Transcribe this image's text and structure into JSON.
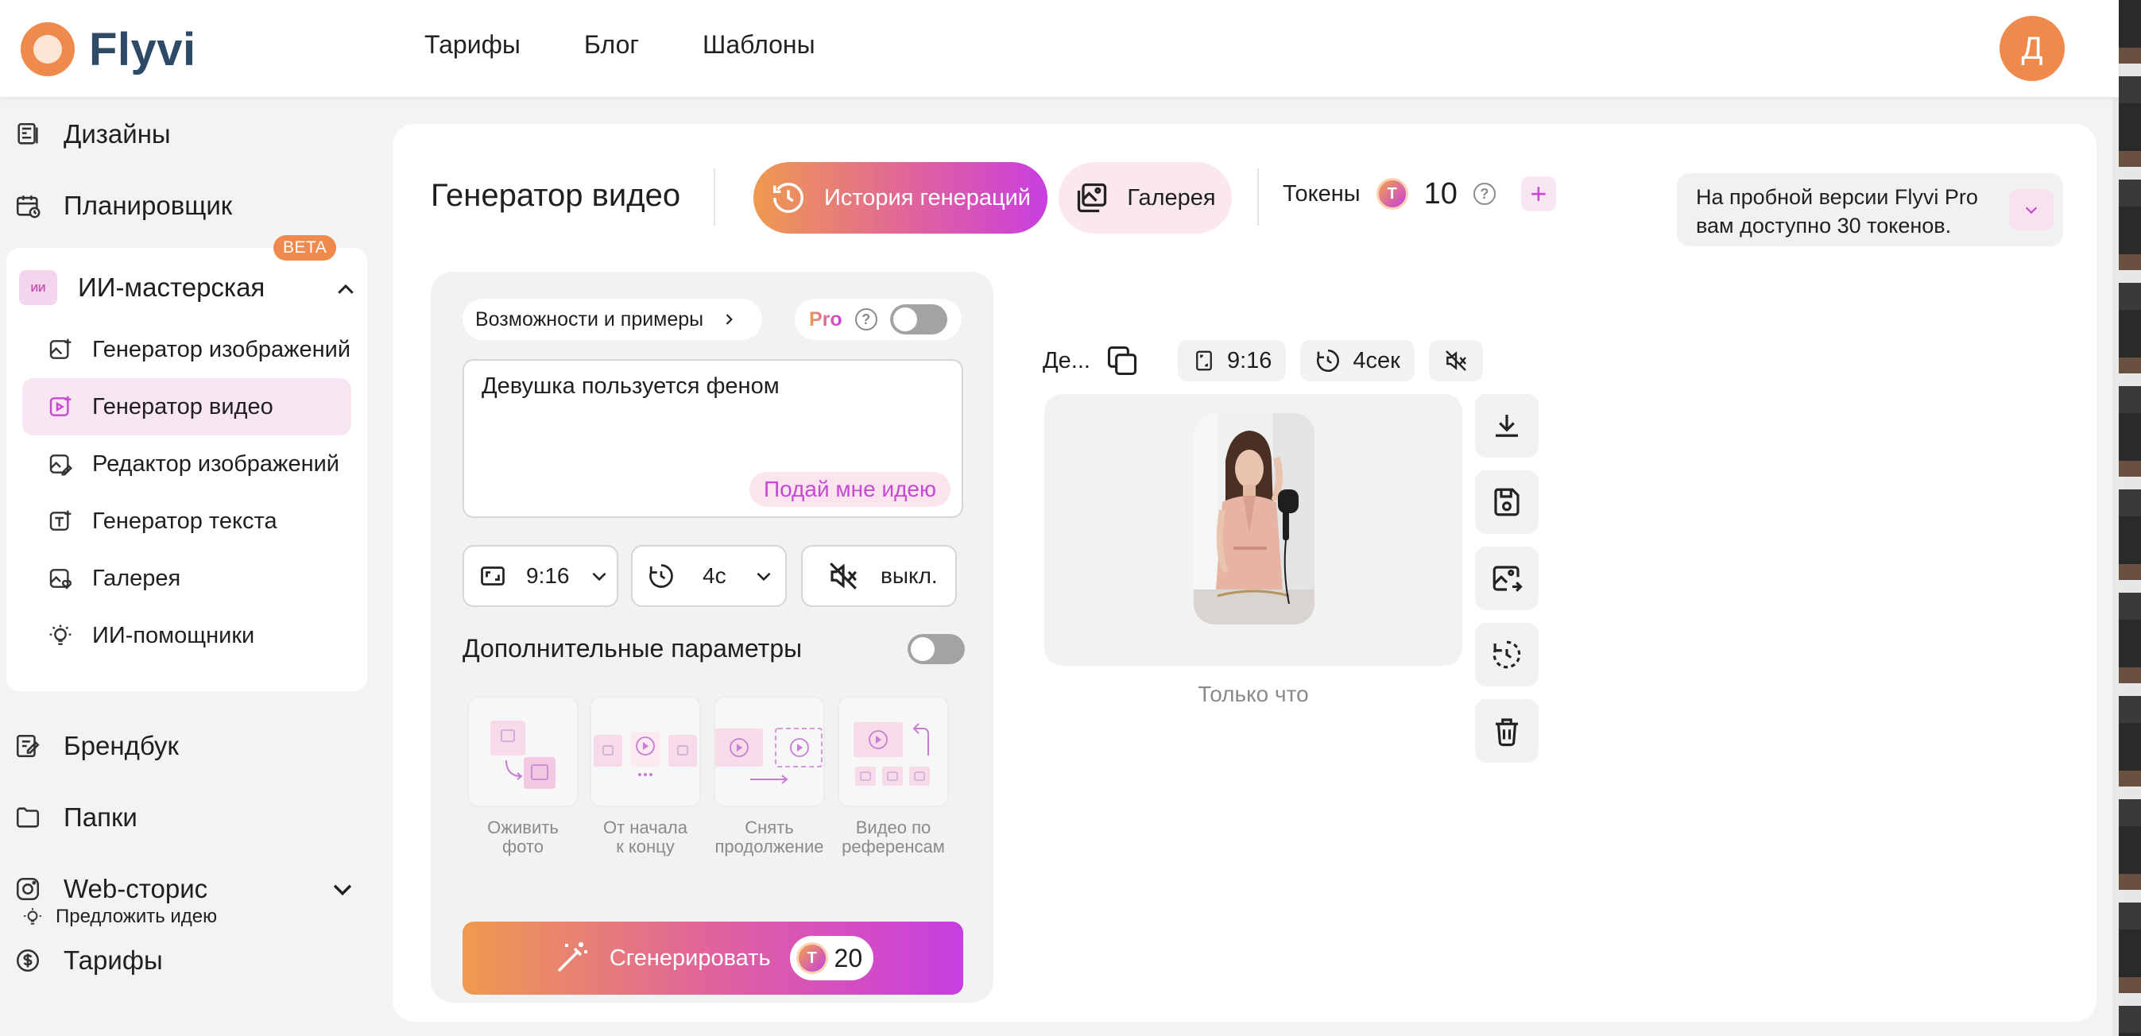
{
  "header": {
    "logo_text": "Flyvi",
    "nav": [
      "Тарифы",
      "Блог",
      "Шаблоны"
    ],
    "avatar_letter": "Д"
  },
  "sidebar": {
    "top_items": [
      "Дизайны",
      "Планировщик"
    ],
    "ai_section": {
      "label": "ИИ-мастерская",
      "badge": "BETA",
      "icon_text": "ИИ",
      "items": [
        {
          "label": "Генератор изображений",
          "active": false
        },
        {
          "label": "Генератор видео",
          "active": true
        },
        {
          "label": "Редактор изображений",
          "active": false
        },
        {
          "label": "Генератор текста",
          "active": false
        },
        {
          "label": "Галерея",
          "active": false
        },
        {
          "label": "ИИ-помощники",
          "active": false
        }
      ]
    },
    "bottom_items": [
      "Брендбук",
      "Папки",
      "Web-сторис",
      "Тарифы"
    ],
    "suggest_label": "Предложить идею"
  },
  "main": {
    "title": "Генератор видео",
    "history_label": "История генераций",
    "gallery_label": "Галерея",
    "tokens_label": "Токены",
    "token_coin": "T",
    "tokens_count": "10",
    "trial_text_line1": "На пробной версии Flyvi Pro",
    "trial_text_line2": "вам доступно 30 токенов."
  },
  "form": {
    "capabilities_label": "Возможности и примеры",
    "pro_label": "Pro",
    "pro_enabled": false,
    "prompt_value": "Девушка пользуется феном",
    "idea_button": "Подай мне идею",
    "aspect_value": "9:16",
    "duration_value": "4с",
    "sound_value": "выкл.",
    "advanced_label": "Дополнительные параметры",
    "advanced_enabled": false,
    "modes": [
      {
        "line1": "Оживить",
        "line2": "фото"
      },
      {
        "line1": "От начала",
        "line2": "к концу"
      },
      {
        "line1": "Снять",
        "line2": "продолжение"
      },
      {
        "line1": "Видео по",
        "line2": "референсам"
      }
    ],
    "generate_label": "Сгенерировать",
    "generate_cost": "20"
  },
  "result": {
    "title_truncated": "Де...",
    "aspect": "9:16",
    "duration": "4сек",
    "time_label": "Только что"
  },
  "colors": {
    "brand_orange": "#ef8a4c",
    "brand_navy": "#2e4a67",
    "gradient_start": "#ef9a4f",
    "gradient_end": "#c83ee2",
    "active_bg": "#f8e6f2",
    "idea_text": "#c449d3"
  }
}
